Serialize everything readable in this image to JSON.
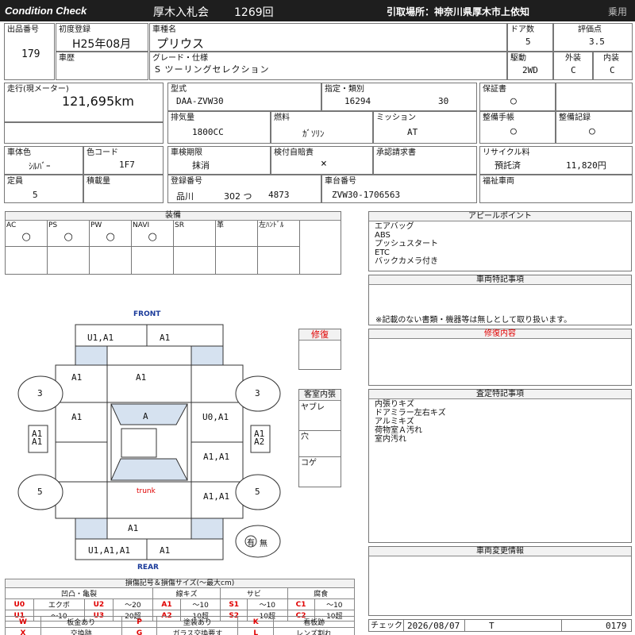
{
  "header": {
    "brand": "Condition  Check",
    "auction": "厚木入札会",
    "lot_session": "1269回",
    "pickup": "引取場所：神奈川県厚木市上依知",
    "category": "乗用"
  },
  "row1": {
    "lot_label": "出品番号",
    "lot_value": "179",
    "reg_label": "初度登録",
    "reg_value": "H25年08月",
    "model_label": "車種名",
    "model_value": "プリウス",
    "doors_label": "ドア数",
    "doors_value": "5",
    "score_label": "評価点",
    "score_value": "3.5",
    "history_label": "車歴",
    "grade_label": "グレード・仕様",
    "grade_value": "S ツーリングセレクション",
    "drive_label": "駆動",
    "drive_value": "2WD",
    "ext_label": "外装",
    "ext_value": "C",
    "int_label": "内装",
    "int_value": "C"
  },
  "row2": {
    "mileage_label": "走行(現メーター)",
    "mileage_value": "121,695km",
    "type_label": "型式",
    "type_value": "DAA-ZVW30",
    "spec_label": "指定・類別",
    "spec_value1": "16294",
    "spec_value2": "30",
    "warranty_label": "保証書",
    "warranty_value": "○",
    "displacement_label": "排気量",
    "displacement_value": "1800CC",
    "fuel_label": "燃料",
    "fuel_value": "ｶﾞｿﾘﾝ",
    "mission_label": "ミッション",
    "mission_value": "AT",
    "manual_label": "整備手帳",
    "manual_value": "○",
    "record_label": "整備記録",
    "record_value": "○"
  },
  "row3": {
    "color_label": "車体色",
    "color_value": "ｼﾙﾊﾞｰ",
    "colorcode_label": "色コード",
    "colorcode_value": "1F7",
    "inspect_label": "車検期限",
    "inspect_value": "抹消",
    "insurance_label": "検付自賠責",
    "insurance_value": "×",
    "approval_label": "承認請求書",
    "recycle_label": "リサイクル料",
    "recycle_status": "預託済",
    "recycle_amount": "11,820円",
    "capacity_label": "定員",
    "capacity_value": "5",
    "load_label": "積載量",
    "plate_label": "登録番号",
    "plate_region": "品川",
    "plate_class": "302 つ",
    "plate_number": "4873",
    "chassis_label": "車台番号",
    "chassis_value": "ZVW30-1706563",
    "welfare_label": "福祉車両"
  },
  "equipment": {
    "title": "装備",
    "items": [
      {
        "label": "AC",
        "value": "○"
      },
      {
        "label": "PS",
        "value": "○"
      },
      {
        "label": "PW",
        "value": "○"
      },
      {
        "label": "NAVI",
        "value": "○"
      },
      {
        "label": "SR",
        "value": ""
      },
      {
        "label": "革",
        "value": ""
      },
      {
        "label": "左ﾊﾝﾄﾞﾙ",
        "value": ""
      }
    ]
  },
  "appeal": {
    "title": "アピールポイント",
    "lines": [
      "エアバッグ",
      "ABS",
      "プッシュスタート",
      "ETC",
      "バックカメラ付き"
    ]
  },
  "special": {
    "title": "車両特記事項",
    "note": "※記載のない書類・機器等は無しとして取り扱います。"
  },
  "repair": {
    "title": "修復内容",
    "side_label": "修復"
  },
  "assessment": {
    "title": "査定特記事項",
    "lines": [
      "内張りキズ",
      "ドアミラー左右キズ",
      "アルミキズ",
      "荷物室Ａ汚れ",
      "室内汚れ"
    ]
  },
  "interior": {
    "title": "客室内張",
    "rows": [
      "ヤブレ",
      "穴",
      "コゲ"
    ]
  },
  "change": {
    "title": "車両変更情報"
  },
  "check": {
    "label": "チェック",
    "date": "2026/08/07",
    "mark": "T",
    "number": "0179"
  },
  "diagram": {
    "front": "FRONT",
    "rear": "REAR",
    "trunk": "trunk",
    "front_left": "U1,A1",
    "front_right": "A1",
    "hood_left": "A1",
    "hood_center": "A1",
    "windshield": "A",
    "left_front_door": "A1",
    "left_side_1": "A1",
    "left_side_2": "A1",
    "right_front_door": "U0,A1",
    "right_side_1": "A1",
    "right_side_2": "A2",
    "right_rear_door": "A1,A1",
    "right_quarter": "A1,A1",
    "rear_center": "A1",
    "rear_left": "U1,A1,A1",
    "rear_right": "A1",
    "tire_fl": "3",
    "tire_fr": "3",
    "tire_rl": "5",
    "tire_rr": "5",
    "spare_label": "有",
    "spare_status": "無"
  },
  "legend": {
    "title": "損傷記号＆損傷サイズ(～最大cm)",
    "groups": [
      "凹凸・亀裂",
      "線キズ",
      "サビ",
      "腐食"
    ],
    "rows": [
      [
        {
          "c": "U0",
          "t": "エクボ"
        },
        {
          "c": "U2",
          "t": "～20"
        },
        {
          "c": "A1",
          "t": "～10"
        },
        {
          "c": "S1",
          "t": "～10"
        },
        {
          "c": "C1",
          "t": "～10"
        }
      ],
      [
        {
          "c": "U1",
          "t": "～10"
        },
        {
          "c": "U3",
          "t": "20超"
        },
        {
          "c": "A2",
          "t": "10超"
        },
        {
          "c": "S2",
          "t": "10超"
        },
        {
          "c": "C2",
          "t": "10超"
        }
      ]
    ],
    "marks": [
      [
        {
          "c": "W",
          "t": "板金あり"
        },
        {
          "c": "P",
          "t": "塗装あり"
        },
        {
          "c": "K",
          "t": "看板跡"
        }
      ],
      [
        {
          "c": "X",
          "t": "交換跡"
        },
        {
          "c": "G",
          "t": "ガラス交換要す"
        },
        {
          "c": "L",
          "t": "レンズ割れ"
        }
      ]
    ]
  }
}
